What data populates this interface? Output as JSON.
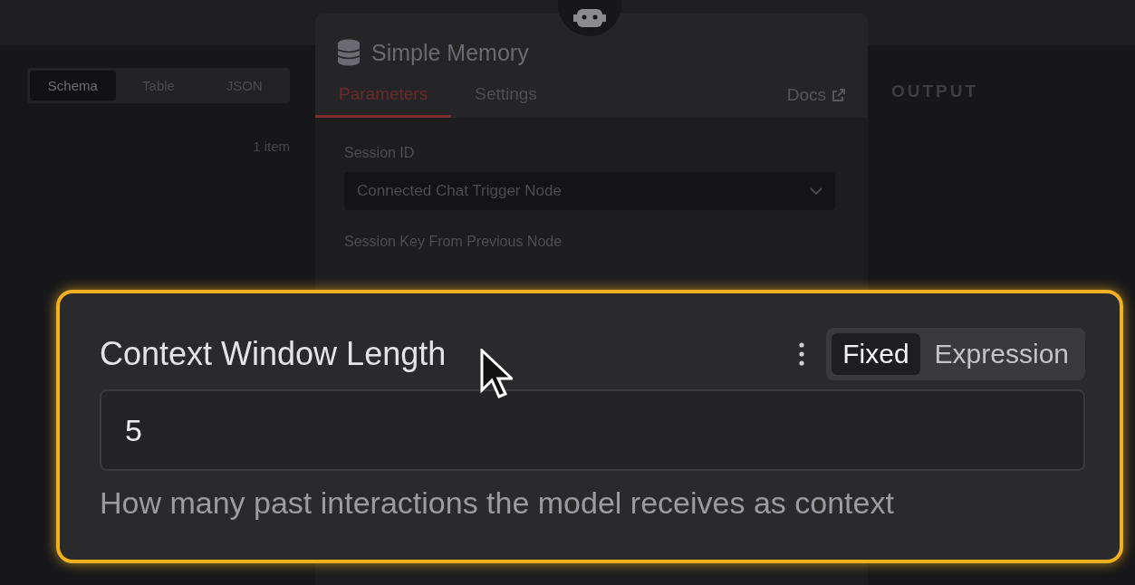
{
  "input_panel": {
    "view_tabs": [
      {
        "label": "Schema",
        "selected": true
      },
      {
        "label": "Table",
        "selected": false
      },
      {
        "label": "JSON",
        "selected": false
      }
    ],
    "item_count": "1 item"
  },
  "node_panel": {
    "title": "Simple Memory",
    "tabs": [
      {
        "label": "Parameters",
        "selected": true
      },
      {
        "label": "Settings",
        "selected": false
      }
    ],
    "docs_link": "Docs",
    "fields": [
      {
        "label": "Session ID",
        "value": "Connected Chat Trigger Node"
      },
      {
        "label": "Session Key From Previous Node"
      }
    ]
  },
  "output_panel": {
    "title": "OUTPUT"
  },
  "highlight": {
    "label": "Context Window Length",
    "modes": [
      {
        "label": "Fixed",
        "selected": true
      },
      {
        "label": "Expression",
        "selected": false
      }
    ],
    "value": "5",
    "hint": "How many past interactions the model receives as context"
  }
}
